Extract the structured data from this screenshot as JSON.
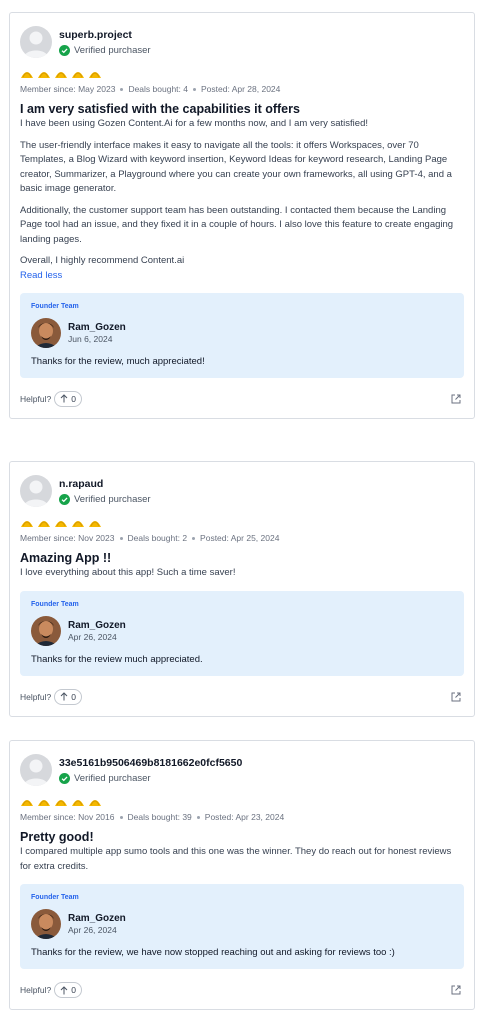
{
  "colors": {
    "accent": "#2563eb",
    "verified": "#16a34a",
    "founder_bg": "#e3f0fc",
    "star": "#f5b800"
  },
  "icons": {
    "verified": "check-circle-icon",
    "star": "taco-star-icon",
    "helpful": "arrow-up-icon",
    "share": "external-link-icon"
  },
  "reviews": [
    {
      "username": "superb.project",
      "verified_label": "Verified purchaser",
      "rating": 5,
      "member_since": "Member since: May 2023",
      "deals_bought": "Deals bought: 4",
      "posted": "Posted: Apr 28, 2024",
      "title": "I am very satisfied with the capabilities it offers",
      "paragraphs": [
        "I have been using Gozen Content.Ai for a few months now, and I am very satisfied!",
        "The user-friendly interface makes it easy to navigate all the tools: it offers Workspaces, over 70 Templates, a Blog Wizard with keyword insertion, Keyword Ideas for keyword research, Landing Page creator, Summarizer, a Playground where you can create your own frameworks, all using GPT-4, and a basic image generator.",
        "Additionally, the customer support team has been outstanding. I contacted them because the Landing Page tool had an issue, and they fixed it in a couple of hours. I also love this feature to create engaging landing pages.",
        "Overall, I highly recommend Content.ai"
      ],
      "read_less": "Read less",
      "founder": {
        "label": "Founder Team",
        "name": "Ram_Gozen",
        "date": "Jun 6, 2024",
        "reply": "Thanks for the review, much appreciated!"
      },
      "helpful_label": "Helpful?",
      "helpful_count": "0"
    },
    {
      "username": "n.rapaud",
      "verified_label": "Verified purchaser",
      "rating": 5,
      "member_since": "Member since: Nov 2023",
      "deals_bought": "Deals bought: 2",
      "posted": "Posted: Apr 25, 2024",
      "title": "Amazing App !!",
      "paragraphs": [
        "I love everything about this app! Such a time saver!"
      ],
      "founder": {
        "label": "Founder Team",
        "name": "Ram_Gozen",
        "date": "Apr 26, 2024",
        "reply": "Thanks for the review much appreciated."
      },
      "helpful_label": "Helpful?",
      "helpful_count": "0"
    },
    {
      "username": "33e5161b9506469b8181662e0fcf5650",
      "verified_label": "Verified purchaser",
      "rating": 5,
      "member_since": "Member since: Nov 2016",
      "deals_bought": "Deals bought: 39",
      "posted": "Posted: Apr 23, 2024",
      "title": "Pretty good!",
      "paragraphs": [
        "I compared multiple app sumo tools and this one was the winner. They do reach out for honest reviews for extra credits."
      ],
      "founder": {
        "label": "Founder Team",
        "name": "Ram_Gozen",
        "date": "Apr 26, 2024",
        "reply": "Thanks for the review, we have now stopped reaching out and asking for reviews too :)"
      },
      "helpful_label": "Helpful?",
      "helpful_count": "0"
    }
  ]
}
